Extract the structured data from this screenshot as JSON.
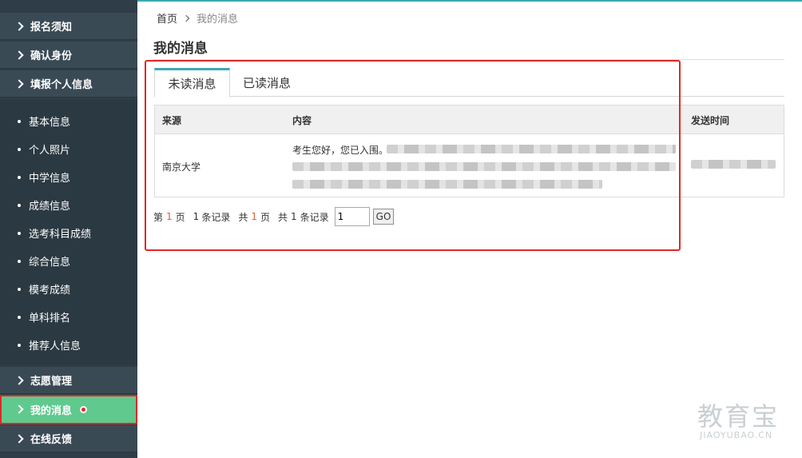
{
  "sidebar": {
    "headers_top": [
      {
        "label": "报名须知"
      },
      {
        "label": "确认身份"
      },
      {
        "label": "填报个人信息"
      }
    ],
    "sub_items": [
      {
        "label": "基本信息"
      },
      {
        "label": "个人照片"
      },
      {
        "label": "中学信息"
      },
      {
        "label": "成绩信息"
      },
      {
        "label": "选考科目成绩"
      },
      {
        "label": "综合信息"
      },
      {
        "label": "模考成绩"
      },
      {
        "label": "单科排名"
      },
      {
        "label": "推荐人信息"
      }
    ],
    "headers_bottom": [
      {
        "label": "志愿管理"
      },
      {
        "label": "我的消息",
        "active": true
      },
      {
        "label": "在线反馈"
      }
    ],
    "colors": {
      "bg": "#2e3d47",
      "active": "#5fc98e",
      "badge": "#e02828"
    }
  },
  "breadcrumb": {
    "home": "首页",
    "current": "我的消息"
  },
  "page": {
    "title": "我的消息"
  },
  "tabs": [
    {
      "label": "未读消息",
      "active": true
    },
    {
      "label": "已读消息",
      "active": false
    }
  ],
  "table": {
    "headers": {
      "source": "来源",
      "content": "内容",
      "time": "发送时间"
    },
    "rows": [
      {
        "source": "南京大学",
        "content_visible": "考生您好，您已入围。"
      }
    ]
  },
  "pager": {
    "prefix_page": "第",
    "current_page": "1",
    "suffix_page": "页",
    "records_on_page": "1",
    "suffix_records": "条记录",
    "total_prefix": "共",
    "total_pages": "1",
    "total_pages_suffix": "页",
    "total_records_prefix": "共",
    "total_records": "1",
    "total_records_suffix": "条记录",
    "input_value": "1",
    "go_label": "GO"
  },
  "watermark": {
    "main": "教育宝",
    "sub": "JIAOYUBAO.CN"
  }
}
